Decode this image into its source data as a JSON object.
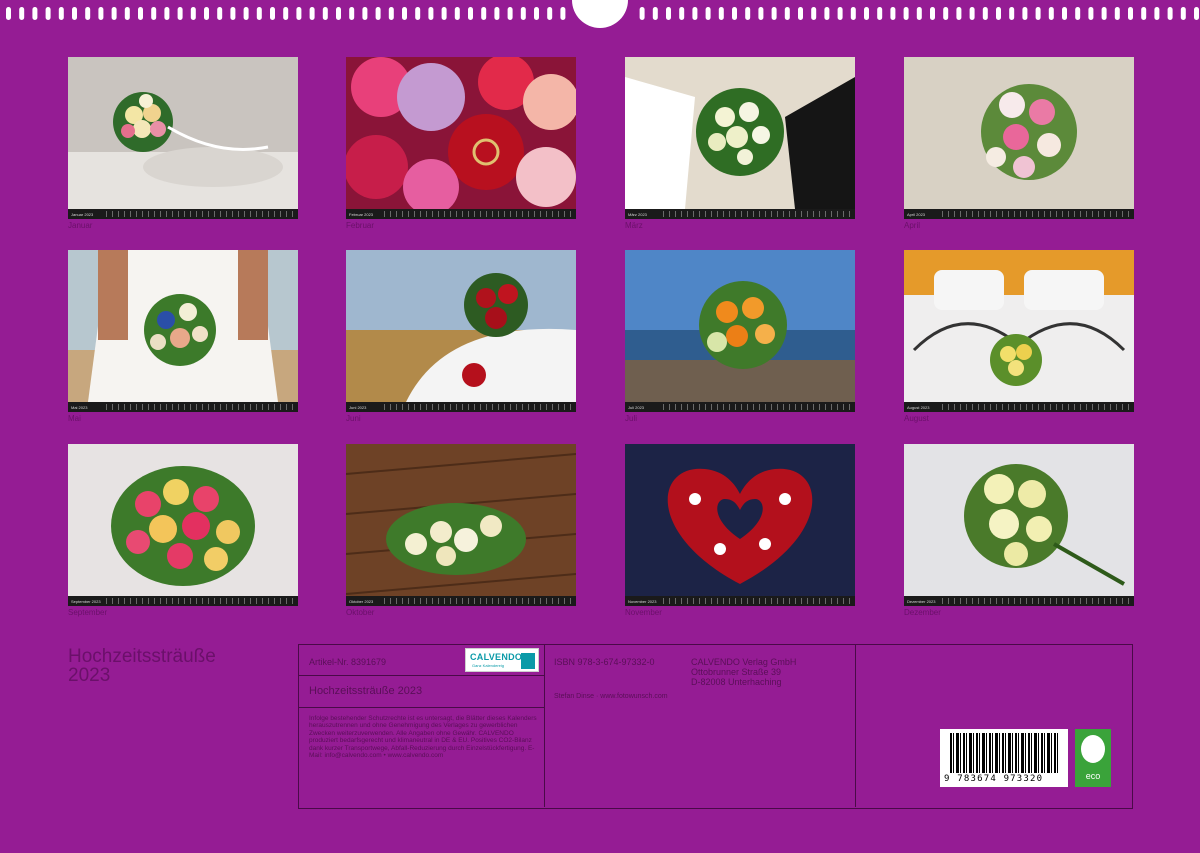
{
  "months": [
    {
      "caption": "Januar",
      "strip": "Januar 2023"
    },
    {
      "caption": "Februar",
      "strip": "Februar 2023"
    },
    {
      "caption": "März",
      "strip": "März 2023"
    },
    {
      "caption": "April",
      "strip": "April 2023"
    },
    {
      "caption": "Mai",
      "strip": "Mai 2023"
    },
    {
      "caption": "Juni",
      "strip": "Juni 2023"
    },
    {
      "caption": "Juli",
      "strip": "Juli 2023"
    },
    {
      "caption": "August",
      "strip": "August 2023"
    },
    {
      "caption": "September",
      "strip": "September 2023"
    },
    {
      "caption": "Oktober",
      "strip": "Oktober 2023"
    },
    {
      "caption": "November",
      "strip": "November 2023"
    },
    {
      "caption": "Dezember",
      "strip": "Dezember 2023"
    }
  ],
  "title_line1": "Hochzeitssträuße",
  "title_line2": "2023",
  "info": {
    "article": "Artikel-Nr. 8391679",
    "calendar_title": "Hochzeitssträuße 2023",
    "isbn": "ISBN 978-3-674-97332-0",
    "publisher_name": "CALVENDO Verlag GmbH",
    "publisher_street": "Ottobrunner Straße 39",
    "publisher_city": "D-82008 Unterhaching",
    "photographer": "Stefan Dinse · www.fotowunsch.com",
    "legal": "Infolge bestehender Schutzrechte ist es untersagt, die Blätter dieses Kalenders herauszutrennen und ohne Genehmigung des Verlages zu gewerblichen Zwecken weiterzuverwenden. Alle Angaben ohne Gewähr. CALVENDO produziert bedarfsgerecht und klimaneutral in DE & EU. Positives CO2-Bilanz dank kurzer Transportwege, Abfall-Reduzierung durch Einzelstückfertigung. E-Mail: info@calvendo.com • www.calvendo.com"
  },
  "logo": {
    "name": "CALVENDO",
    "sub": "Ganz Kalendereig"
  },
  "barcode_number": "9 783674 973320",
  "eco_label": "eco",
  "colors": {
    "background": "#951c94",
    "frame": "#4a0a48",
    "eco": "#3aa33a"
  }
}
